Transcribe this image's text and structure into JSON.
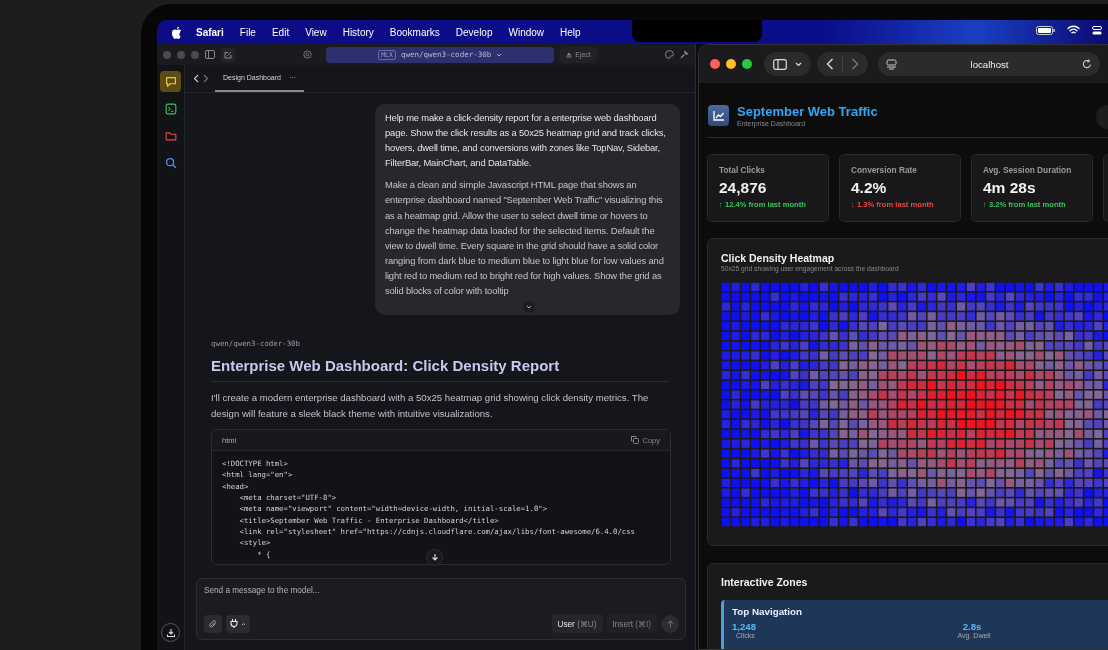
{
  "menu_bar": {
    "items": [
      "Safari",
      "File",
      "Edit",
      "View",
      "History",
      "Bookmarks",
      "Develop",
      "Window",
      "Help"
    ]
  },
  "chat_app": {
    "model_selector": {
      "tag": "MLX",
      "model": "qwen/qwen3-coder-30b"
    },
    "eject": "Eject",
    "rail": [
      {
        "kind": "chat",
        "selected": true
      },
      {
        "kind": "terminal",
        "selected": false
      },
      {
        "kind": "folder",
        "selected": false
      },
      {
        "kind": "search",
        "selected": false
      }
    ],
    "tab": {
      "label": "Design Dashboard",
      "more": "···"
    },
    "user_message": [
      "Help me make a click-density report for a enterprise web dashboard page. Show the click results as a 50x25 heatmap grid and track clicks, hovers, dwell time, and conversions with zones like TopNav, Sidebar, FilterBar, MainChart, and DataTable.",
      "Make a clean and simple Javascript HTML page that shows an enterprise dashboard named \"September Web Traffic\" visualizing this as a heatmap grid. Allow the user to select dwell time or hovers to change the heatmap data loaded for the selected items. Default the view to dwell time. Every square in the grid should have a solid color ranging from dark blue to medium blue to light blue for low values and light red to medium red to bright red for high values. Show the grid as solid blocks of color with tooltip"
    ],
    "assistant": {
      "model": "qwen/qwen3-coder-30b",
      "heading": "Enterprise Web Dashboard: Click Density Report",
      "text": "I'll create a modern enterprise dashboard with a 50x25 heatmap grid showing click density metrics. The design will feature a sleek black theme with intuitive visualizations."
    },
    "code_block": {
      "language": "html",
      "copy": "Copy",
      "lines": [
        "<!DOCTYPE html>",
        "<html lang=\"en\">",
        "<head>",
        "    <meta charset=\"UTF-8\">",
        "    <meta name=\"viewport\" content=\"width=device-width, initial-scale=1.0\">",
        "    <title>September Web Traffic - Enterprise Dashboard</title>",
        "    <link rel=\"stylesheet\" href=\"https://cdnjs.cloudflare.com/ajax/libs/font-awesome/6.4.0/css",
        "    <style>",
        "        * {"
      ]
    },
    "composer": {
      "placeholder": "Send a message to the model...",
      "user_button": {
        "label": "User",
        "shortcut": "(⌘U)",
        "selected": true
      },
      "insert_button": {
        "label": "Insert",
        "shortcut": "(⌘I)",
        "selected": false
      }
    }
  },
  "browser": {
    "url": "localhost",
    "dashboard": {
      "title": "September Web Traffic",
      "subtitle": "Enterprise Dashboard",
      "stats": [
        {
          "label": "Total Clicks",
          "value": "24,876",
          "change": "↑ 12.4% from last month",
          "color": "#37c45a"
        },
        {
          "label": "Conversion Rate",
          "value": "4.2%",
          "change": "↓ 1.3% from last month",
          "color": "#f04444"
        },
        {
          "label": "Avg. Session Duration",
          "value": "4m 28s",
          "change": "↑ 3.2% from last month",
          "color": "#37c45a"
        }
      ],
      "heatmap": {
        "title": "Click Density Heatmap",
        "subtitle": "50x25 grid showing user engagement across the dashboard"
      },
      "zones": {
        "title": "Interactive Zones",
        "items": [
          {
            "name": "Top Navigation",
            "metrics": [
              {
                "value": "1,248",
                "label": "Clicks"
              },
              {
                "value": "2.8s",
                "label": "Avg. Dwell"
              }
            ]
          }
        ]
      }
    }
  }
}
